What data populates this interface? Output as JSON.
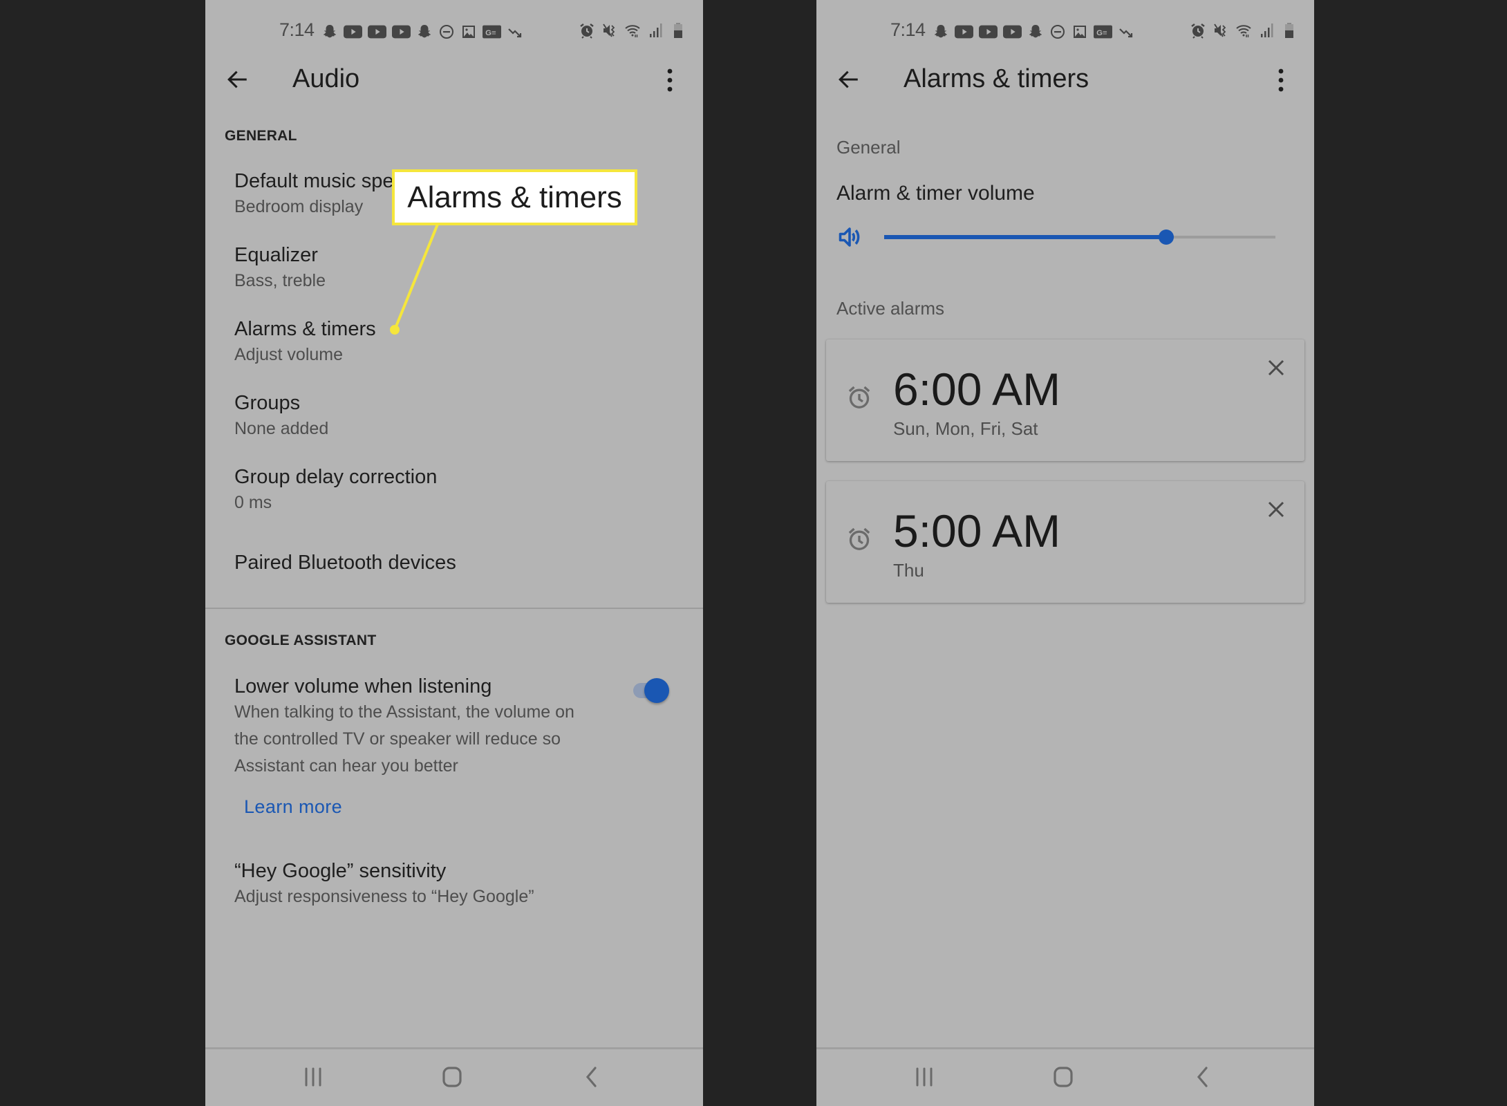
{
  "status_bar": {
    "time": "7:14",
    "left_icons": [
      "snapchat-icon",
      "youtube-icon",
      "youtube-icon",
      "youtube-icon",
      "snapchat-icon",
      "do-not-disturb-icon",
      "gallery-icon",
      "ge-icon",
      "trending-down-icon"
    ],
    "right_icons": [
      "alarm-icon",
      "vibrate-mute-icon",
      "wifi-icon",
      "signal-icon",
      "battery-icon"
    ]
  },
  "left_screen": {
    "title": "Audio",
    "sections": [
      {
        "header": "GENERAL",
        "items": [
          {
            "title": "Default music speaker",
            "subtitle": "Bedroom display"
          },
          {
            "title": "Equalizer",
            "subtitle": "Bass, treble"
          },
          {
            "title": "Alarms & timers",
            "subtitle": "Adjust volume"
          },
          {
            "title": "Groups",
            "subtitle": "None added"
          },
          {
            "title": "Group delay correction",
            "subtitle": "0 ms"
          },
          {
            "title": "Paired Bluetooth devices",
            "subtitle": ""
          }
        ]
      },
      {
        "header": "GOOGLE ASSISTANT",
        "items": [
          {
            "title": "Lower volume when listening",
            "subtitle_lines": [
              "When talking to the Assistant, the volume on",
              "the controlled TV or speaker will reduce so",
              "Assistant can hear you better"
            ],
            "toggle_on": true,
            "link": "Learn more"
          },
          {
            "title": "“Hey Google” sensitivity",
            "subtitle": "Adjust responsiveness to “Hey Google”"
          }
        ]
      }
    ],
    "callout": {
      "text": "Alarms & timers",
      "color": "#f5e63c"
    }
  },
  "right_screen": {
    "title": "Alarms & timers",
    "general_label": "General",
    "volume_label": "Alarm & timer volume",
    "volume_fraction": 0.72,
    "active_label": "Active alarms",
    "alarms": [
      {
        "time": "6:00 AM",
        "days": "Sun, Mon, Fri, Sat"
      },
      {
        "time": "5:00 AM",
        "days": "Thu"
      }
    ]
  },
  "colors": {
    "accent": "#1a57b3",
    "background": "#232323",
    "screen": "#b4b4b4",
    "callout": "#f5e63c"
  }
}
